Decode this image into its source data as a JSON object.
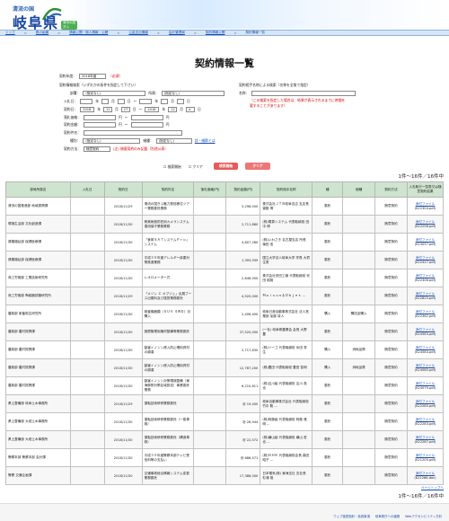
{
  "header": {
    "logo_sub": "清流の国",
    "logo_main": "岐阜県",
    "logo_badge": "清流の国ぎふ"
  },
  "breadcrumb": [
    "トップ",
    "県の組織",
    "情報公開・個人情報・公聴",
    "公金支出情報",
    "会計管理局",
    "契約情報公開",
    "契約情報一覧"
  ],
  "page_title": "契約情報一覧",
  "form": {
    "year_label": "契約年度：",
    "year_value": "2018年度",
    "year_required": "（必須）",
    "search_info_label": "契約情報検索（いずれかの条件を指定して下さい）",
    "dept_label": "部署：",
    "dept_value": "(指定なし)",
    "section_label": "所属：",
    "section_value": "(指定なし)",
    "nyusatsu_label": "入札日：",
    "contract_date_label": "契約日：",
    "contract_from_year": "2018",
    "contract_from_month": "11",
    "contract_from_day": "27",
    "contract_to_year": "2018",
    "contract_to_month": "12",
    "contract_to_day": "4",
    "min_price_label": "落札価格：",
    "amount_label": "契約金額：",
    "name_label": "契約件名：",
    "kind_label": "種別：",
    "kind_value": "(指定なし)",
    "region_label": "細種：",
    "region_value": "(指定なし)",
    "region_link": "詳・細節とは",
    "method_label": "契約方法：",
    "method_value": "随意契約",
    "method_note": "(注) 随意契約のみ記載（別途公表）",
    "partner_label": "契約相手名称による検索（名称を全角で指定）",
    "partner_name_label": "名称：",
    "partner_note": "（この検索を指定した場合は、結果が表示されるまでに時間を要することがあります）",
    "unit_year": "年",
    "unit_month": "月",
    "unit_day": "日",
    "unit_yen": "円"
  },
  "buttons": {
    "search_toggle": "検索開始",
    "clear_toggle": "クリア",
    "search": "検索開始",
    "clear": "クリア"
  },
  "result_count": "1件～16件／16件中",
  "page_link": "ページトップへ",
  "table": {
    "headers": [
      "部局所属名",
      "入札日",
      "契約日",
      "契約件名",
      "落札価格(円)",
      "契約金額(円)",
      "契約相手名称",
      "種",
      "細種",
      "契約方法",
      "入札執行一覧表又は随意契約結果"
    ],
    "rows": [
      [
        "清流の国推進部 地域振興課",
        "",
        "2018/11/29",
        "清流の国ぎふ魅力発信移住ツアー業務委託業務",
        "",
        "3,298,000",
        "株式会社ＪＴＢ岐阜支店 支店長 齋藤 博",
        "委託",
        "",
        "随意契約",
        "添付ファイル",
        "(K22304.pdf)"
      ],
      [
        "環境生活部 文化創造課",
        "",
        "2018/11/30",
        "県美術館防犯用カメラシステム運用保守業務業務",
        "",
        "2,711,880",
        "(株)電算システム 代表取締役 田中 博",
        "委託",
        "",
        "随意契約",
        "添付ファイル",
        "(K22298.pdf)"
      ],
      [
        "健康福祉部 保健医療課",
        "",
        "2018/11/30",
        "「食育ＳＡＴシステムＰｒｏ」システム",
        "",
        "4,807,280",
        "(株)いわさき 名古屋支店 所長 篠田 信",
        "委託",
        "",
        "随意契約",
        "添付ファイル",
        "(K23057.pdf)"
      ],
      [
        "健康福祉部 保健医療課",
        "",
        "2018/11/30",
        "平成３０年度アレルギー疾患対策推進業務",
        "",
        "1,393,939",
        "国立大学法人岐阜大学 学長 大賀 生男",
        "委託",
        "",
        "随意契約",
        "添付ファイル",
        "(K22427.pdf)"
      ],
      [
        "商工労働部 工業技術研究所",
        "",
        "2018/11/30",
        "レオロメーター式",
        "",
        "2,646,000",
        "株式会社安田工機 代表取締役 安田 昭雄",
        "委託",
        "",
        "随意契約",
        "添付ファイル",
        "(K22306.pdf)"
      ],
      [
        "商工労働部 陶磁器試験研究所",
        "",
        "2018/11/29",
        "「メゾン エ オブジェ」出展ブース出展料及び運営業務委託",
        "",
        "4,920,000",
        "Ｍａｉｓｏｎ＆Ｏｂｊｅｔ ...",
        "委託",
        "",
        "随意契約",
        "添付ファイル",
        "(K22825.pdf)"
      ],
      [
        "農政部 家畜衛生研究所",
        "",
        "2018/11/30",
        "検査機器類（ＳＵＶ ４ＷＤ）月購入",
        "",
        "2,406,400",
        "岐阜日産自動車株式会社 法人営業部 加藤 将人",
        "購入",
        "購送品購入",
        "随意契約",
        "添付ファイル",
        "(K22362.pdf)"
      ],
      [
        "農政部 農村振興課",
        "",
        "2018/11/30",
        "施肥管理用機材整備等業務委託",
        "",
        "37,520,000",
        "(一社) 岐阜県農業会 会長 大野 豊",
        "委託",
        "",
        "随意契約",
        "添付ファイル",
        "(K24583.pdf)"
      ],
      [
        "農政部 農村振興課",
        "",
        "2018/11/30",
        "獣害イノシシ侵入防止柵用資材の調達",
        "",
        "2,717,630",
        "(株)ソーゴ 代表取締役 永田 秀生",
        "購入",
        "消耗品費",
        "随意契約",
        "添付ファイル",
        "(K24584.pdf)"
      ],
      [
        "農政部 農村振興課",
        "",
        "2018/11/30",
        "獣害イノシシ侵入防止柵用資材の調達",
        "",
        "12,787,200",
        "(株)豊田 代表取締役 豊田 智明",
        "購入",
        "消耗品費",
        "随意契約",
        "添付ファイル",
        "(K24585.pdf)"
      ],
      [
        "農政部 農村振興課",
        "",
        "2018/11/30",
        "獣害イノシシ対策環境整備（東海豚熱対策区域設定）事業委託業務",
        "",
        "6,210,611",
        "(株)吉川組 代表取締役 吉川 貴也",
        "委託",
        "",
        "随意契約",
        "添付ファイル",
        "(K24579.pdf)"
      ],
      [
        "県土整備部 岐阜土木事務所",
        "",
        "2018/11/29",
        "運転技術研修業務委託",
        "",
        "@ 19,400",
        "岐阜自動車株式会社 代表取締役 竹中 聡 ...",
        "委託",
        "",
        "随意契約",
        "添付ファイル",
        "(K22285.pdf)"
      ],
      [
        "県土整備部 大垣土木事務所",
        "",
        "2018/11/30",
        "運転技術研修業務委託（一般車検）",
        "",
        "@ 28,944",
        "(株)阿藤組 代表取締役 阿藤 雅明 ...",
        "委託",
        "",
        "随意契約",
        "添付ファイル",
        "(K22283.pdf)"
      ],
      [
        "県土整備部 大垣土木事務所",
        "",
        "2018/11/30",
        "運転技術研修業務委託（構造車検）",
        "",
        "@ 22,572",
        "(株)横山組 代表取締役 横山 哲也 ...",
        "委託",
        "",
        "随意契約",
        "添付ファイル",
        "(K22287.pdf)"
      ],
      [
        "警察本部 警察本部 会計課",
        "",
        "2018/11/30",
        "平成３０年度警察本部テレビ受信料等の支払い",
        "",
        "@ 886,571",
        "(株)ＮＨＫ 代表取締役会長 森田昭子 ...",
        "委託",
        "",
        "随意契約",
        "添付ファイル",
        "(K21205.pdf)"
      ],
      [
        "警察 交通企画課",
        "",
        "2018/11/30",
        "交通事故総合情報システム変更業務委託",
        "",
        "17,388,000",
        "日本電気(株) 東海支社 支社長 杉浦 雄",
        "委託",
        "",
        "随意契約",
        "添付ファイル",
        "(K22286.doc)"
      ]
    ]
  },
  "footer": {
    "links": [
      "ウェブ運営指針・免責事項",
      "岐阜県庁への道順",
      "Webアクセシビリティ方針"
    ]
  }
}
